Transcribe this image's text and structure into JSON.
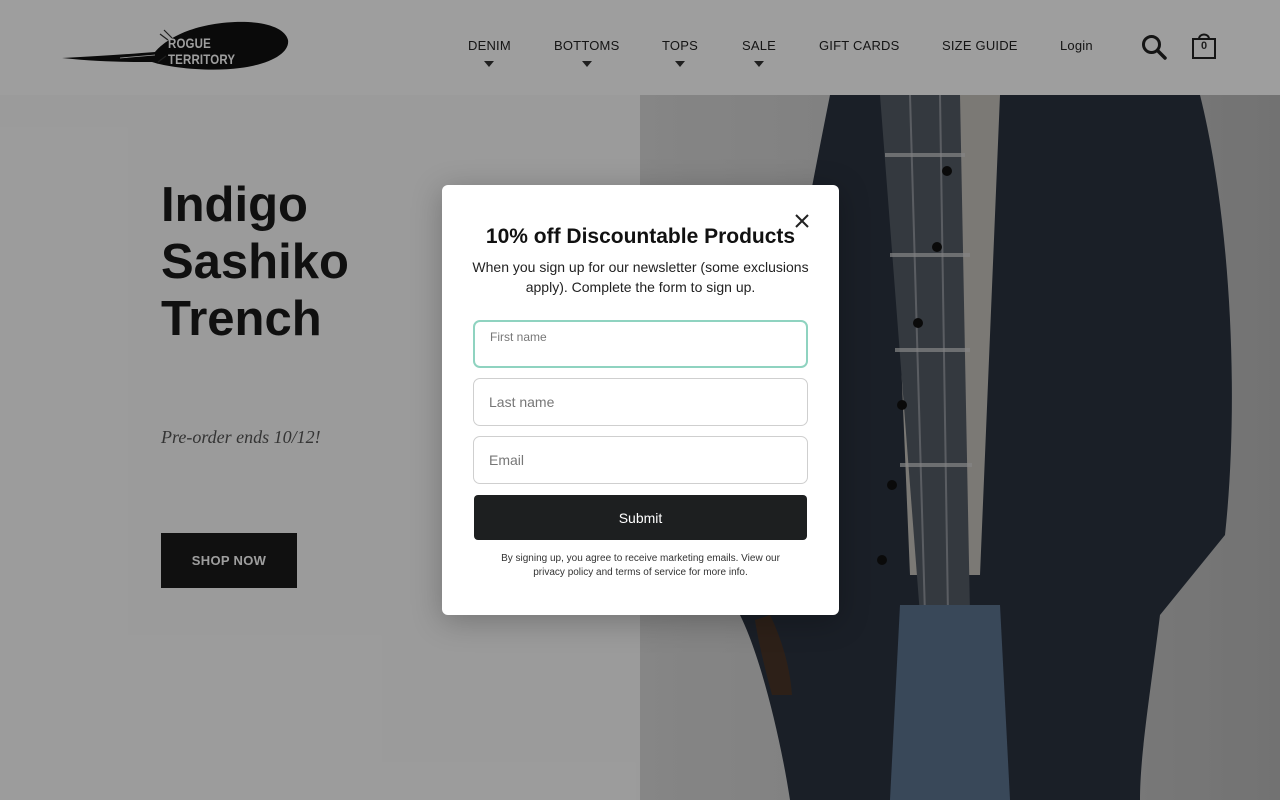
{
  "brand": {
    "name": "ROGUE TERRITORY"
  },
  "nav": {
    "items": [
      {
        "label": "DENIM",
        "has_dropdown": true
      },
      {
        "label": "BOTTOMS",
        "has_dropdown": true
      },
      {
        "label": "TOPS",
        "has_dropdown": true
      },
      {
        "label": "SALE",
        "has_dropdown": true
      },
      {
        "label": "GIFT CARDS",
        "has_dropdown": false
      },
      {
        "label": "SIZE GUIDE",
        "has_dropdown": false
      },
      {
        "label": "Login",
        "has_dropdown": false
      }
    ],
    "search_icon": "search-icon",
    "cart_icon": "shopping-bag-icon",
    "cart_count": "0"
  },
  "hero": {
    "title_lines": [
      "Indigo",
      "Sashiko",
      "Trench"
    ],
    "subtitle": "Pre-order ends 10/12!",
    "cta_label": "SHOP NOW"
  },
  "modal": {
    "title": "10% off Discountable Products",
    "description": "When you sign up for our newsletter (some exclusions apply). Complete the form to sign up.",
    "fields": {
      "first_name": {
        "label": "First name",
        "value": ""
      },
      "last_name": {
        "placeholder": "Last name",
        "value": ""
      },
      "email": {
        "placeholder": "Email",
        "value": ""
      }
    },
    "submit_label": "Submit",
    "legal": "By signing up, you agree to receive marketing emails. View our privacy policy and terms of service for more info.",
    "close_icon": "close-icon"
  },
  "colors": {
    "primary": "#1b1b1b",
    "focus_border": "#8fd3c0",
    "overlay": "rgba(0,0,0,0.38)"
  }
}
